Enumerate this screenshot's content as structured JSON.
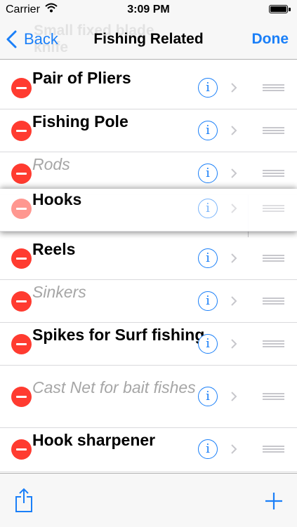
{
  "status": {
    "carrier": "Carrier",
    "time": "3:09 PM"
  },
  "nav": {
    "back_label": "Back",
    "title": "Fishing Related",
    "done_label": "Done",
    "ghost_text_1": "Small fixed blade",
    "ghost_text_2": "knife"
  },
  "rows": [
    {
      "label": "Pair of Pliers",
      "style": "bold"
    },
    {
      "label": "Fishing Pole",
      "style": "bold"
    },
    {
      "label": "Rods",
      "style": "italic-gray"
    },
    {
      "label": "Hooks",
      "style": "bold",
      "state": "dragging"
    },
    {
      "label": "Reels",
      "style": "bold"
    },
    {
      "label": "Sinkers",
      "style": "italic-gray"
    },
    {
      "label": "Spikes for Surf fishing",
      "style": "bold"
    },
    {
      "label": "Cast Net for bait fishes",
      "style": "italic-gray"
    },
    {
      "label": "Hook sharpener",
      "style": "bold"
    }
  ],
  "icons": {
    "delete": "minus-circle-icon",
    "info": "info-icon",
    "disclosure": "chevron-right-icon",
    "reorder": "reorder-grip-icon",
    "share": "share-icon",
    "add": "plus-icon"
  },
  "colors": {
    "accent": "#1a7ff8",
    "delete": "#ff3b30",
    "muted_text": "#a6a6a6"
  }
}
